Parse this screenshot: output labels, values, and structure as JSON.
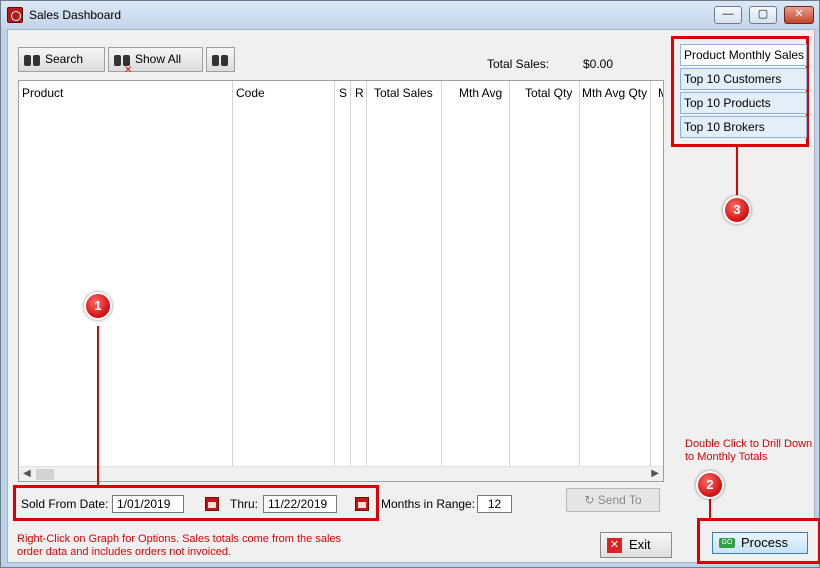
{
  "window": {
    "title": "Sales Dashboard"
  },
  "toolbar": {
    "search_label": "Search",
    "show_all_label": "Show All"
  },
  "totals": {
    "label": "Total Sales:",
    "value": "$0.00"
  },
  "grid": {
    "columns": [
      "Product",
      "Code",
      "S",
      "R",
      "Total Sales",
      "Mth Avg",
      "Total Qty",
      "Mth Avg Qty",
      "M"
    ]
  },
  "date_range": {
    "from_label": "Sold From Date:",
    "from_value": "1/01/2019",
    "thru_label": "Thru:",
    "thru_value": "11/22/2019",
    "months_label": "Months in Range:",
    "months_value": "12"
  },
  "actions": {
    "send_to_label": "Send To",
    "exit_label": "Exit",
    "process_label": "Process"
  },
  "side_menu": {
    "items": [
      {
        "label": "Product Monthly Sales"
      },
      {
        "label": "Top 10 Customers"
      },
      {
        "label": "Top 10 Products"
      },
      {
        "label": "Top 10 Brokers"
      }
    ]
  },
  "notes": {
    "help_text": "Right-Click on Graph for Options.  Sales totals come from the sales order data and includes orders not invoiced.",
    "drill_text": "Double Click to Drill Down to Monthly Totals"
  },
  "callouts": {
    "one": "1",
    "two": "2",
    "three": "3"
  },
  "colors": {
    "highlight": "#e00000",
    "client_bg": "#f0f0f0"
  }
}
